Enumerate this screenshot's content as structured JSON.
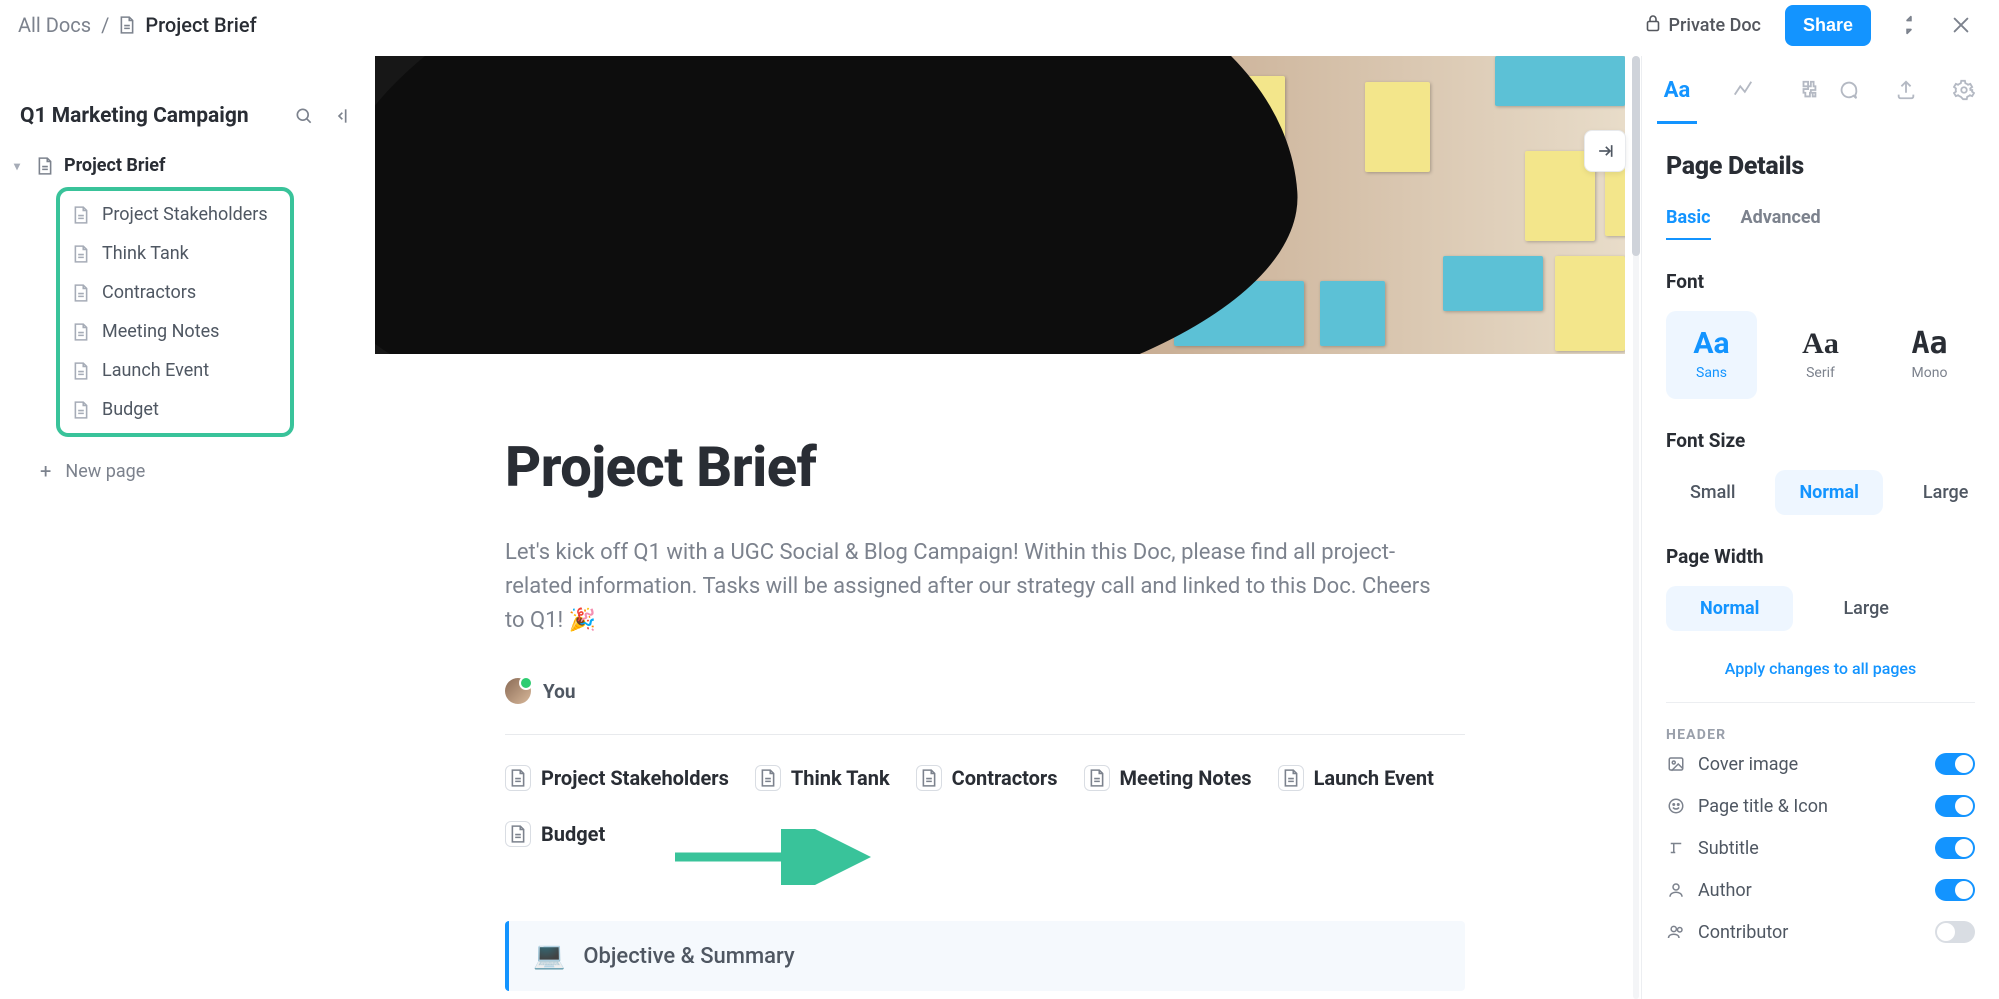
{
  "breadcrumbs": {
    "root": "All Docs",
    "sep": "/",
    "current": "Project Brief"
  },
  "topright": {
    "private": "Private Doc",
    "share": "Share"
  },
  "sidebar": {
    "title": "Q1 Marketing Campaign",
    "root": "Project Brief",
    "children": [
      "Project Stakeholders",
      "Think Tank",
      "Contractors",
      "Meeting Notes",
      "Launch Event",
      "Budget"
    ],
    "new_page": "New page"
  },
  "doc": {
    "title": "Project Brief",
    "subtitle": "Let's kick off Q1 with a UGC Social & Blog Campaign! Within this Doc, please find all project-related information. Tasks will be assigned after our strategy call and linked to this Doc. Cheers to Q1! 🎉",
    "author": "You",
    "chips": [
      "Project Stakeholders",
      "Think Tank",
      "Contractors",
      "Meeting Notes",
      "Launch Event",
      "Budget"
    ],
    "callout": {
      "emoji": "💻",
      "text": "Objective & Summary"
    }
  },
  "panel": {
    "title": "Page Details",
    "tabs": {
      "basic": "Basic",
      "advanced": "Advanced"
    },
    "font_section": "Font",
    "fonts": {
      "sans": "Sans",
      "serif": "Serif",
      "mono": "Mono",
      "sample": "Aa"
    },
    "font_size_section": "Font Size",
    "sizes": {
      "small": "Small",
      "normal": "Normal",
      "large": "Large"
    },
    "width_section": "Page Width",
    "widths": {
      "normal": "Normal",
      "large": "Large"
    },
    "apply_all": "Apply changes to all pages",
    "header_section": "HEADER",
    "toggles": {
      "cover": {
        "label": "Cover image",
        "on": true
      },
      "title_icon": {
        "label": "Page title & Icon",
        "on": true
      },
      "subtitle": {
        "label": "Subtitle",
        "on": true
      },
      "author": {
        "label": "Author",
        "on": true
      },
      "contributor": {
        "label": "Contributor",
        "on": false
      }
    }
  }
}
